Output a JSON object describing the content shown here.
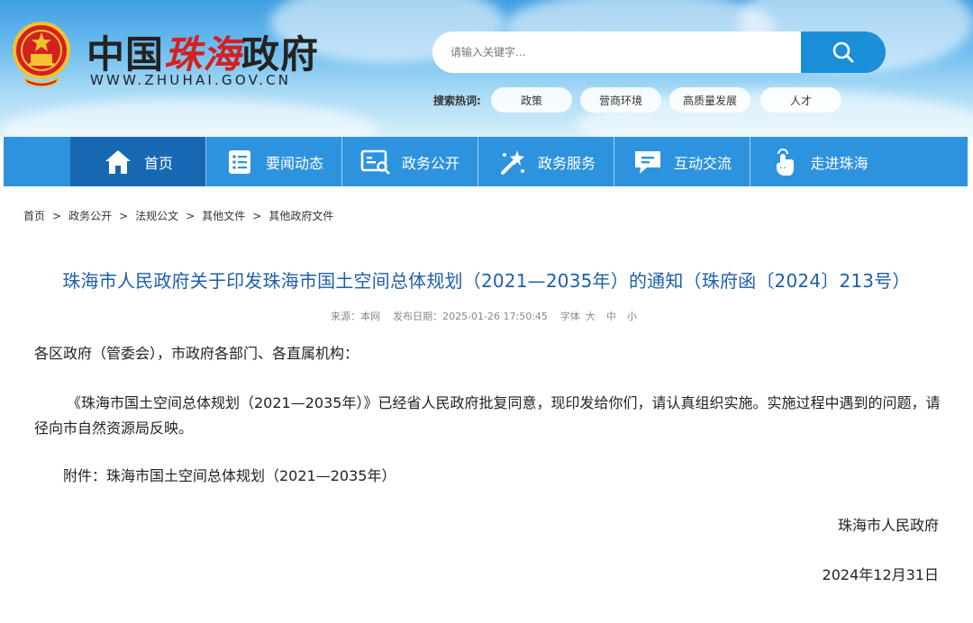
{
  "header": {
    "site_title_a": "中国",
    "site_title_b": "珠海",
    "site_title_c": "政府",
    "site_url": "WWW.ZHUHAI.GOV.CN"
  },
  "search": {
    "placeholder": "请输入关键字..."
  },
  "hot": {
    "label": "搜索热词:",
    "tags": [
      "政策",
      "营商环境",
      "高质量发展",
      "人才"
    ]
  },
  "nav": {
    "items": [
      {
        "label": "首页",
        "icon": "home-icon"
      },
      {
        "label": "要闻动态",
        "icon": "news-icon"
      },
      {
        "label": "政务公开",
        "icon": "disclosure-icon"
      },
      {
        "label": "政务服务",
        "icon": "service-icon"
      },
      {
        "label": "互动交流",
        "icon": "chat-icon"
      },
      {
        "label": "走进珠海",
        "icon": "hand-pointer-icon"
      }
    ]
  },
  "breadcrumb": [
    "首页",
    "政务公开",
    "法规公文",
    "其他文件",
    "其他政府文件"
  ],
  "breadcrumb_sep": ">",
  "article": {
    "title": "珠海市人民政府关于印发珠海市国土空间总体规划（2021—2035年）的通知（珠府函〔2024〕213号）",
    "source_label": "来源：本网",
    "date_label": "发布日期：2025-01-26 17:50:45",
    "font_label": "字体",
    "font_large": "大",
    "font_medium": "中",
    "font_small": "小",
    "salutation": "各区政府（管委会），市政府各部门、各直属机构：",
    "body": "《珠海市国土空间总体规划（2021—2035年）》已经省人民政府批复同意，现印发给你们，请认真组织实施。实施过程中遇到的问题，请径向市自然资源局反映。",
    "attachment": "附件：珠海市国土空间总体规划（2021—2035年）",
    "signature": "珠海市人民政府",
    "date": "2024年12月31日"
  },
  "colors": {
    "nav_bg": "#2e93de",
    "nav_active": "#1768b3",
    "title_blue": "#1e5fa8",
    "emblem_red": "#d42020",
    "emblem_gold": "#f2c230"
  }
}
